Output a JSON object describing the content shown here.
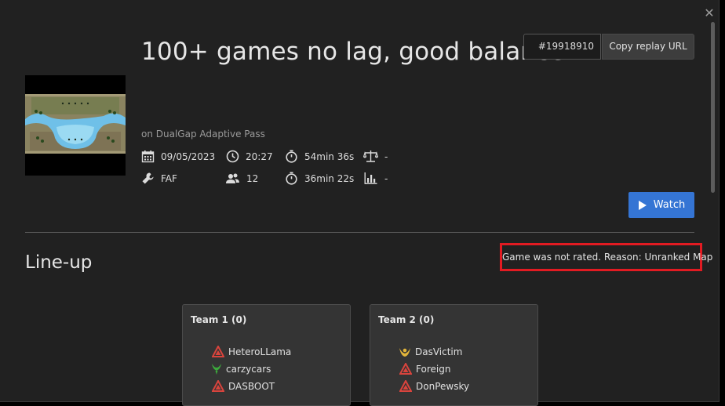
{
  "window": {
    "close_icon": "close-icon",
    "close_glyph": "✕"
  },
  "game": {
    "title": "100+ games no lag, good balance",
    "replay_id": "#19918910",
    "copy_label": "Copy replay URL",
    "map_subtitle": "on DualGap Adaptive Pass",
    "date": "09/05/2023",
    "time": "20:27",
    "duration": "54min 36s",
    "balance": "-",
    "mod": "FAF",
    "players": "12",
    "sim_duration": "36min 22s",
    "rating": "-",
    "watch_label": "Watch"
  },
  "lineup": {
    "heading": "Line-up",
    "unrated_notice": "Game was not rated. Reason: Unranked Map",
    "teams": [
      {
        "title": "Team 1 (0)",
        "players": [
          {
            "name": "HeteroLLama",
            "faction": "cybran",
            "color": "#d9443d"
          },
          {
            "name": "carzycars",
            "faction": "seraphim",
            "color": "#3ca83c"
          },
          {
            "name": "DASBOOT",
            "faction": "cybran",
            "color": "#d9443d"
          }
        ]
      },
      {
        "title": "Team 2 (0)",
        "players": [
          {
            "name": "DasVictim",
            "faction": "aeon",
            "color": "#e1b43a"
          },
          {
            "name": "Foreign",
            "faction": "cybran",
            "color": "#d9443d"
          },
          {
            "name": "DonPewsky",
            "faction": "cybran",
            "color": "#d9443d"
          }
        ]
      }
    ]
  },
  "colors": {
    "accent": "#3575d4",
    "highlight": "#e21b22",
    "background": "#212121"
  }
}
